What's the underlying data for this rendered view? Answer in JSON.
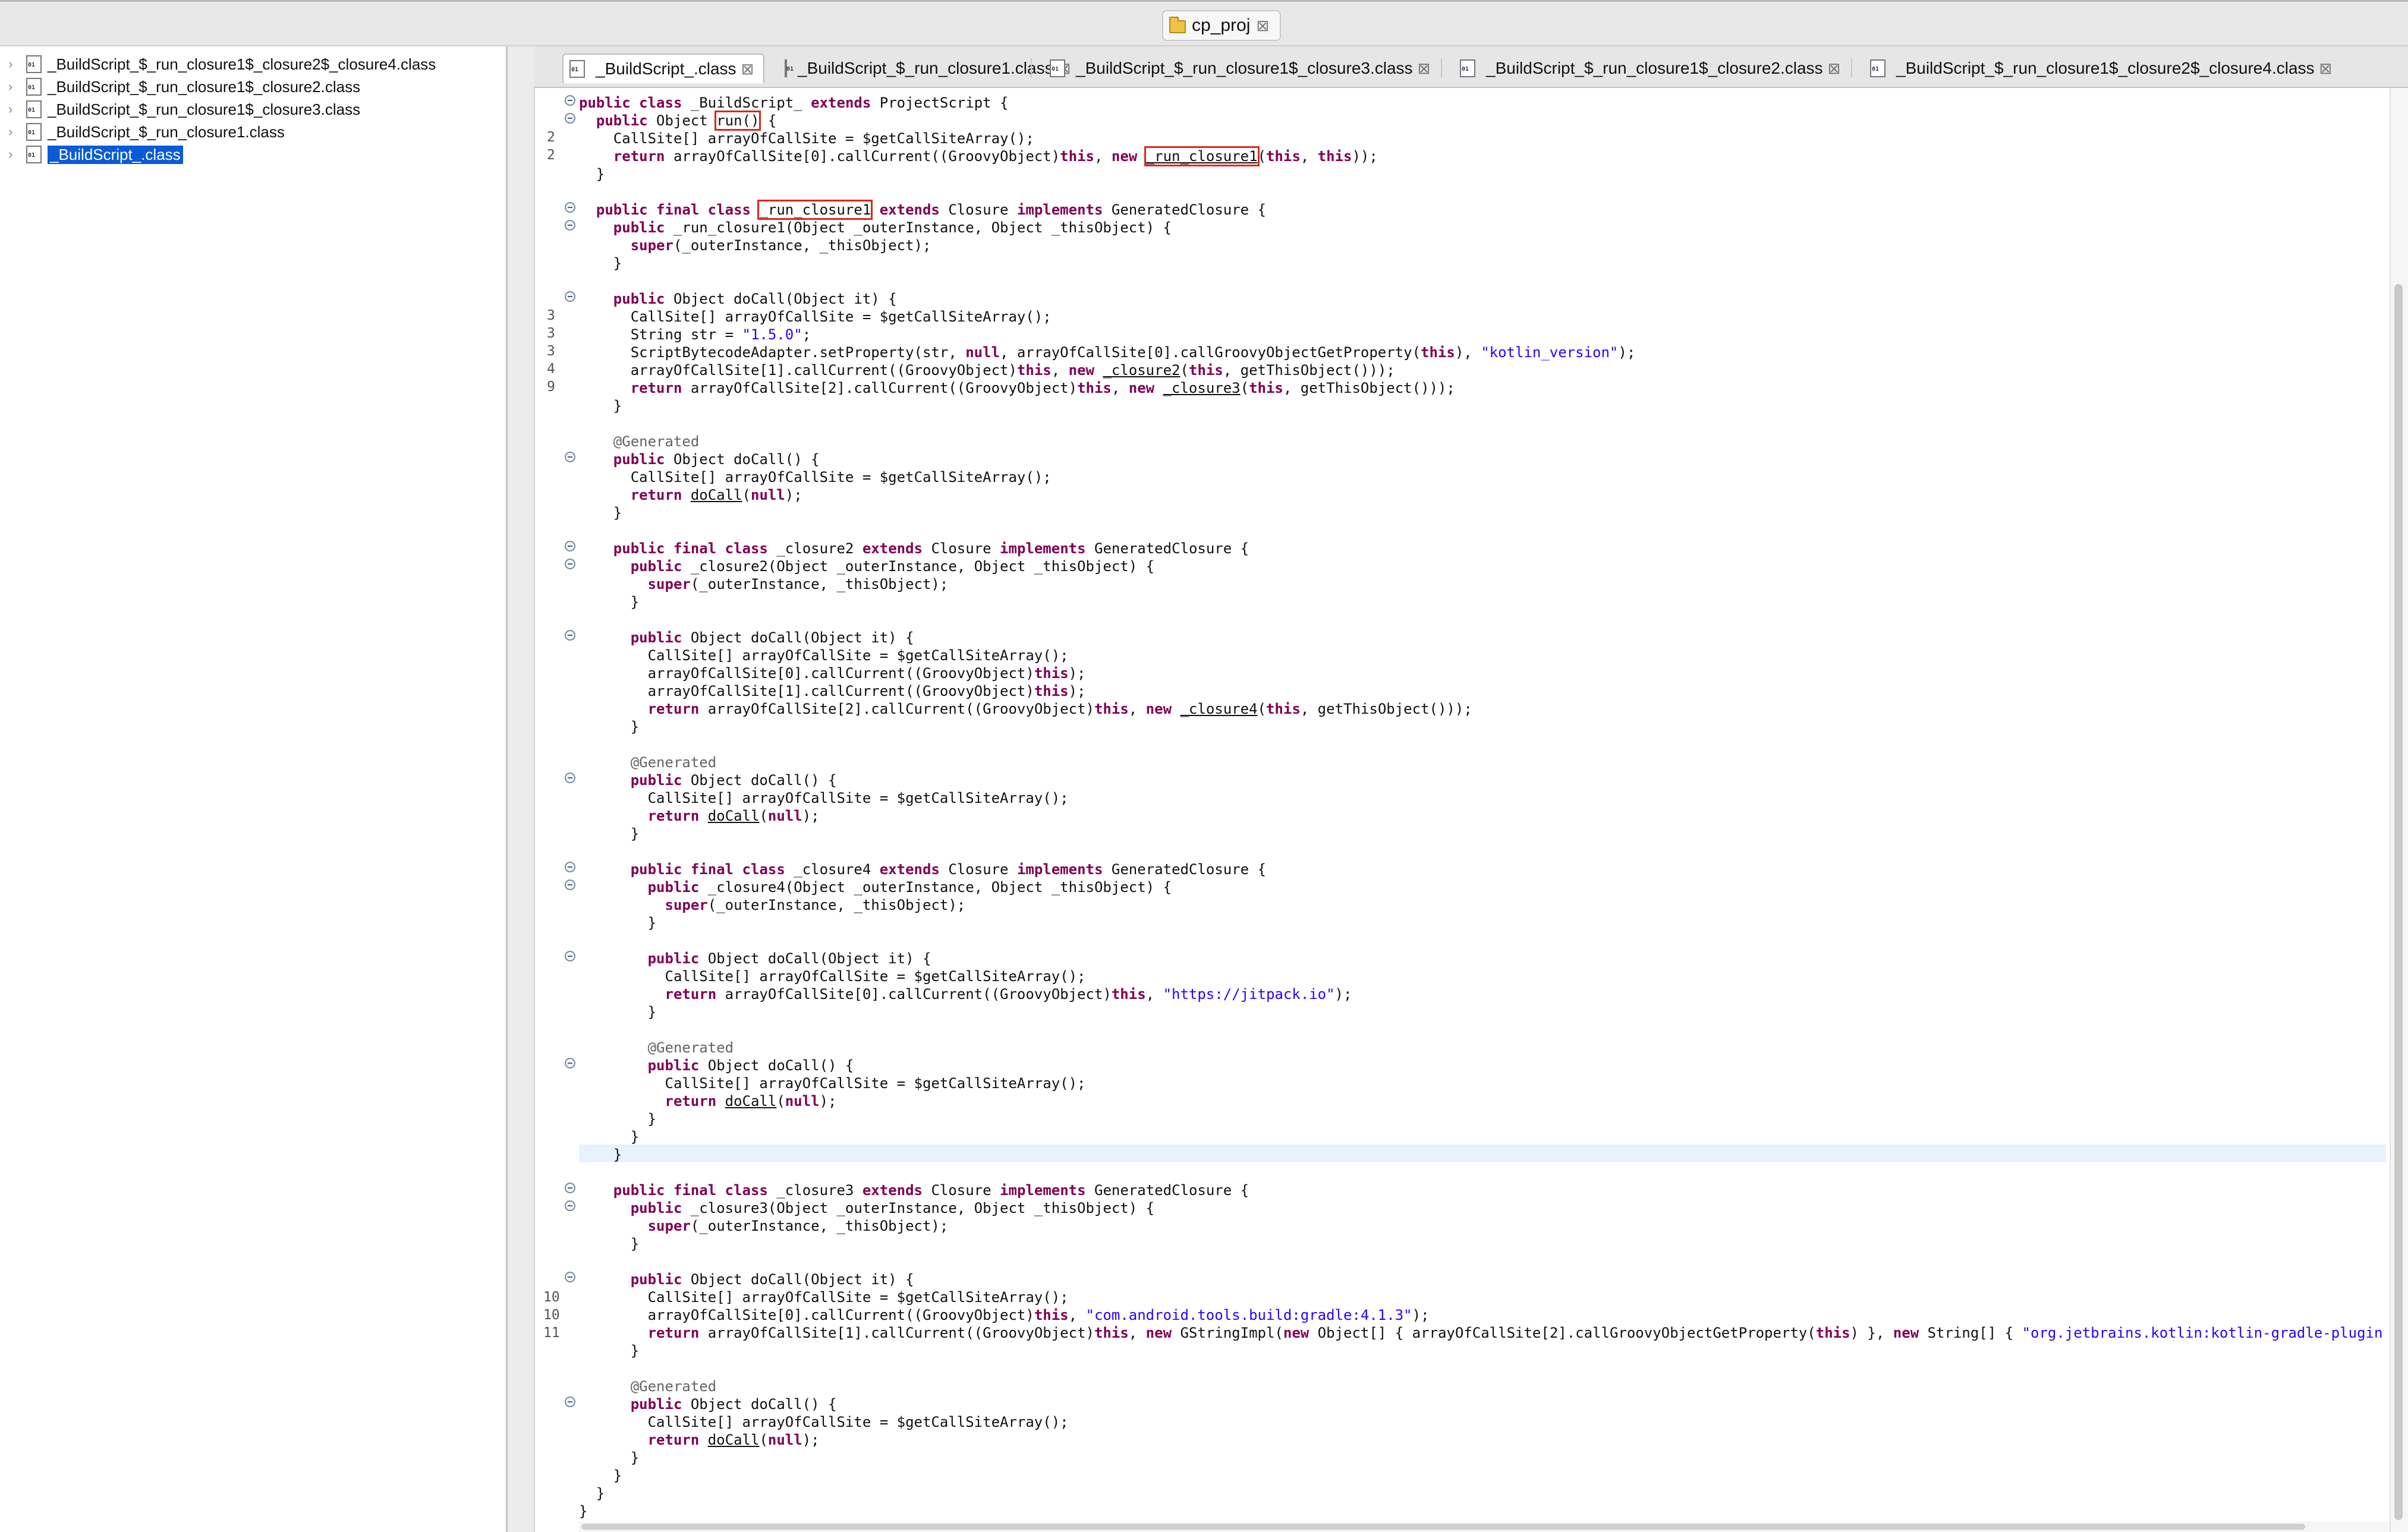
{
  "window": {
    "project_tab": "cp_proj"
  },
  "colors": {
    "keyword": "#7f0055",
    "string": "#2a00ff",
    "annotation": "#646464",
    "selection": "#0a5bd7",
    "highlight_box": "#e0261b"
  },
  "sidebar": {
    "items": [
      {
        "label": "_BuildScript_$_run_closure1$_closure2$_closure4.class"
      },
      {
        "label": "_BuildScript_$_run_closure1$_closure2.class"
      },
      {
        "label": "_BuildScript_$_run_closure1$_closure3.class"
      },
      {
        "label": "_BuildScript_$_run_closure1.class"
      },
      {
        "label": "_BuildScript_.class"
      }
    ]
  },
  "editor_tabs": [
    {
      "label": "_BuildScript_.class"
    },
    {
      "label": "_BuildScript_$_run_closure1.class"
    },
    {
      "label": "_BuildScript_$_run_closure1$_closure3.class"
    },
    {
      "label": "_BuildScript_$_run_closure1$_closure2.class"
    },
    {
      "label": "_BuildScript_$_run_closure1$_closure2$_closure4.class"
    }
  ],
  "gutter": [
    "2",
    "2",
    "3",
    "3",
    "3",
    "4",
    "9",
    "10",
    "10",
    "11"
  ],
  "code": {
    "l1_a": "public class",
    "l1_b": " _BuildScript_ ",
    "l1_c": "extends",
    "l1_d": " ProjectScript {",
    "l2_a": "  public",
    "l2_b": " Object ",
    "l2_c": "run()",
    "l2_d": " {",
    "l3": "    CallSite[] arrayOfCallSite = $getCallSiteArray();",
    "l4_a": "    return",
    "l4_b": " arrayOfCallSite[0].callCurrent((GroovyObject)",
    "l4_c": "this",
    "l4_d": ", ",
    "l4_e": "new",
    "l4_f": " ",
    "l4_g": "_run_closure1",
    "l4_h": "(",
    "l4_i": "this",
    "l4_j": ", ",
    "l4_k": "this",
    "l4_l": "));",
    "l5": "  }",
    "l6_a": "  public final class",
    "l6_b": " ",
    "l6_c": "_run_closure1",
    "l6_d": " ",
    "l6_e": "extends",
    "l6_f": " Closure ",
    "l6_g": "implements",
    "l6_h": " GeneratedClosure {",
    "l7_a": "    public",
    "l7_b": " _run_closure1(Object _outerInstance, Object _thisObject) {",
    "l8_a": "      super",
    "l8_b": "(_outerInstance, _thisObject);",
    "l9": "    }",
    "l10_a": "    public",
    "l10_b": " Object doCall(Object it) {",
    "l11": "      CallSite[] arrayOfCallSite = $getCallSiteArray();",
    "l12_a": "      String str = ",
    "l12_b": "\"1.5.0\"",
    "l12_c": ";",
    "l13_a": "      ScriptBytecodeAdapter.setProperty(str, ",
    "l13_b": "null",
    "l13_c": ", arrayOfCallSite[0].callGroovyObjectGetProperty(",
    "l13_d": "this",
    "l13_e": "), ",
    "l13_f": "\"kotlin_version\"",
    "l13_g": ");",
    "l14_a": "      arrayOfCallSite[1].callCurrent((GroovyObject)",
    "l14_b": "this",
    "l14_c": ", ",
    "l14_d": "new",
    "l14_e": " ",
    "l14_f": "_closure2",
    "l14_g": "(",
    "l14_h": "this",
    "l14_i": ", getThisObject()));",
    "l15_a": "      return",
    "l15_b": " arrayOfCallSite[2].callCurrent((GroovyObject)",
    "l15_c": "this",
    "l15_d": ", ",
    "l15_e": "new",
    "l15_f": " ",
    "l15_g": "_closure3",
    "l15_h": "(",
    "l15_i": "this",
    "l15_j": ", getThisObject()));",
    "l16": "    }",
    "l17": "    @Generated",
    "l18_a": "    public",
    "l18_b": " Object doCall() {",
    "l19": "      CallSite[] arrayOfCallSite = $getCallSiteArray();",
    "l20_a": "      return",
    "l20_b": " ",
    "l20_c": "doCall",
    "l20_d": "(",
    "l20_e": "null",
    "l20_f": ");",
    "l21": "    }",
    "l22_a": "    public final class",
    "l22_b": " _closure2 ",
    "l22_c": "extends",
    "l22_d": " Closure ",
    "l22_e": "implements",
    "l22_f": " GeneratedClosure {",
    "l23_a": "      public",
    "l23_b": " _closure2(Object _outerInstance, Object _thisObject) {",
    "l24_a": "        super",
    "l24_b": "(_outerInstance, _thisObject);",
    "l25": "      }",
    "l26_a": "      public",
    "l26_b": " Object doCall(Object it) {",
    "l27": "        CallSite[] arrayOfCallSite = $getCallSiteArray();",
    "l28_a": "        arrayOfCallSite[0].callCurrent((GroovyObject)",
    "l28_b": "this",
    "l28_c": ");",
    "l29_a": "        arrayOfCallSite[1].callCurrent((GroovyObject)",
    "l29_b": "this",
    "l29_c": ");",
    "l30_a": "        return",
    "l30_b": " arrayOfCallSite[2].callCurrent((GroovyObject)",
    "l30_c": "this",
    "l30_d": ", ",
    "l30_e": "new",
    "l30_f": " ",
    "l30_g": "_closure4",
    "l30_h": "(",
    "l30_i": "this",
    "l30_j": ", getThisObject()));",
    "l31": "      }",
    "l32": "      @Generated",
    "l33_a": "      public",
    "l33_b": " Object doCall() {",
    "l34": "        CallSite[] arrayOfCallSite = $getCallSiteArray();",
    "l35_a": "        return",
    "l35_b": " ",
    "l35_c": "doCall",
    "l35_d": "(",
    "l35_e": "null",
    "l35_f": ");",
    "l36": "      }",
    "l37_a": "      public final class",
    "l37_b": " _closure4 ",
    "l37_c": "extends",
    "l37_d": " Closure ",
    "l37_e": "implements",
    "l37_f": " GeneratedClosure {",
    "l38_a": "        public",
    "l38_b": " _closure4(Object _outerInstance, Object _thisObject) {",
    "l39_a": "          super",
    "l39_b": "(_outerInstance, _thisObject);",
    "l40": "        }",
    "l41_a": "        public",
    "l41_b": " Object doCall(Object it) {",
    "l42": "          CallSite[] arrayOfCallSite = $getCallSiteArray();",
    "l43_a": "          return",
    "l43_b": " arrayOfCallSite[0].callCurrent((GroovyObject)",
    "l43_c": "this",
    "l43_d": ", ",
    "l43_e": "\"https://jitpack.io\"",
    "l43_f": ");",
    "l44": "        }",
    "l45": "        @Generated",
    "l46_a": "        public",
    "l46_b": " Object doCall() {",
    "l47": "          CallSite[] arrayOfCallSite = $getCallSiteArray();",
    "l48_a": "          return",
    "l48_b": " ",
    "l48_c": "doCall",
    "l48_d": "(",
    "l48_e": "null",
    "l48_f": ");",
    "l49": "        }",
    "l50": "      }",
    "l51": "    }",
    "l52_a": "    public final class",
    "l52_b": " _closure3 ",
    "l52_c": "extends",
    "l52_d": " Closure ",
    "l52_e": "implements",
    "l52_f": " GeneratedClosure {",
    "l53_a": "      public",
    "l53_b": " _closure3(Object _outerInstance, Object _thisObject) {",
    "l54_a": "        super",
    "l54_b": "(_outerInstance, _thisObject);",
    "l55": "      }",
    "l56_a": "      public",
    "l56_b": " Object doCall(Object it) {",
    "l57": "        CallSite[] arrayOfCallSite = $getCallSiteArray();",
    "l58_a": "        arrayOfCallSite[0].callCurrent((GroovyObject)",
    "l58_b": "this",
    "l58_c": ", ",
    "l58_d": "\"com.android.tools.build:gradle:4.1.3\"",
    "l58_e": ");",
    "l59_a": "        return",
    "l59_b": " arrayOfCallSite[1].callCurrent((GroovyObject)",
    "l59_c": "this",
    "l59_d": ", ",
    "l59_e": "new",
    "l59_f": " GStringImpl(",
    "l59_g": "new",
    "l59_h": " Object[] { arrayOfCallSite[2].callGroovyObjectGetProperty(",
    "l59_i": "this",
    "l59_j": ") }, ",
    "l59_k": "new",
    "l59_l": " String[] { ",
    "l59_m": "\"org.jetbrains.kotlin:kotlin-gradle-plugin:\"",
    "l59_n": ", ",
    "l59_o": "\"\"",
    "l59_p": " }));",
    "l60": "      }",
    "l61": "      @Generated",
    "l62_a": "      public",
    "l62_b": " Object doCall() {",
    "l63": "        CallSite[] arrayOfCallSite = $getCallSiteArray();",
    "l64_a": "        return",
    "l64_b": " ",
    "l64_c": "doCall",
    "l64_d": "(",
    "l64_e": "null",
    "l64_f": ");",
    "l65": "      }",
    "l66": "    }",
    "l67": "  }",
    "l68": "}"
  }
}
